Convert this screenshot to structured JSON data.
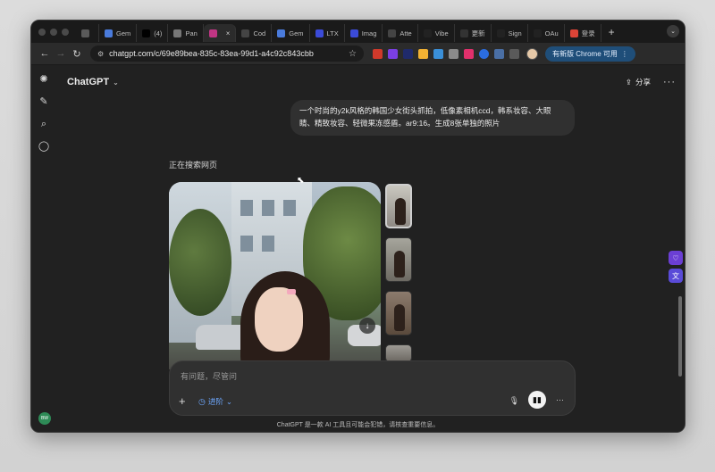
{
  "browser": {
    "tabs": [
      {
        "label": "",
        "icon": "window-icon",
        "color": "#5a5a5a",
        "active": false
      },
      {
        "label": "Gem",
        "icon": "gemini-icon",
        "color": "#4a7bdc",
        "active": false
      },
      {
        "label": "(4) ",
        "icon": "x-icon",
        "color": "#000000",
        "active": false
      },
      {
        "label": "Pan",
        "icon": "globe-icon",
        "color": "#777777",
        "active": false
      },
      {
        "label": "",
        "icon": "instagram-icon",
        "color": "#c13584",
        "active": true
      },
      {
        "label": "Cod",
        "icon": "openai-icon",
        "color": "#444444",
        "active": false
      },
      {
        "label": "Gem",
        "icon": "gemini-icon",
        "color": "#4a7bdc",
        "active": false
      },
      {
        "label": "LTX ",
        "icon": "ltx-icon",
        "color": "#3b4bd8",
        "active": false
      },
      {
        "label": "Imag",
        "icon": "image-icon",
        "color": "#3b4bd8",
        "active": false
      },
      {
        "label": "Atte",
        "icon": "spiral-icon",
        "color": "#444444",
        "active": false
      },
      {
        "label": "Vibe",
        "icon": "vibe-icon",
        "color": "#222222",
        "active": false
      },
      {
        "label": "更新",
        "icon": "update-icon",
        "color": "#333333",
        "active": false
      },
      {
        "label": "Sign",
        "icon": "github-icon",
        "color": "#222222",
        "active": false
      },
      {
        "label": "OAu",
        "icon": "github-icon",
        "color": "#222222",
        "active": false
      },
      {
        "label": "登录",
        "icon": "google-icon",
        "color": "#db4437",
        "active": false
      }
    ],
    "url": "chatgpt.com/c/69e89bea-835c-83ea-99d1-a4c92c843cbb",
    "update_label": "有新版 Chrome 可用"
  },
  "chat": {
    "model": "ChatGPT",
    "share_label": "分享",
    "user_message": "一个时尚的y2k风格的韩国少女街头抓拍，低像素相机ccd，韩系妆容、大眼睛、精致妆容、轻微果冻感盾。ar9:16。生成8张单独的照片",
    "searching_text": "正在搜索网页",
    "composer_placeholder": "有问题，尽管问",
    "mode_label": "进阶",
    "footer": "ChatGPT 是一款 AI 工具且可能会犯错，请核查重要信息。",
    "user_initials": "BW"
  }
}
